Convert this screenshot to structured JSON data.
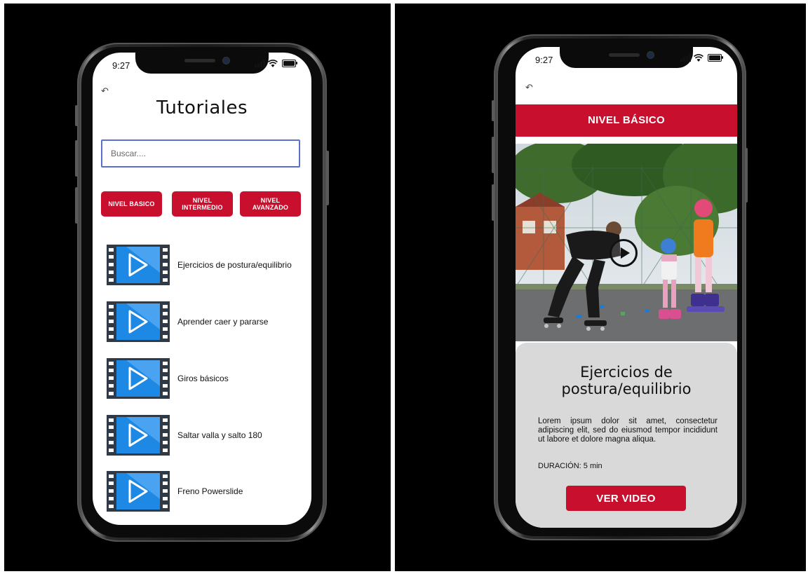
{
  "left_screen": {
    "status": {
      "time": "9:27"
    },
    "back_label": "↶",
    "title": "Tutoriales",
    "search": {
      "placeholder": "Buscar...."
    },
    "levels": [
      {
        "label": "NIVEL BASICO"
      },
      {
        "label": "NIVEL INTERMEDIO"
      },
      {
        "label": "NIVEL AVANZADO"
      }
    ],
    "videos": [
      {
        "title": "Ejercicios de postura/equilibrio",
        "icon": "video-file-icon"
      },
      {
        "title": "Aprender caer y pararse",
        "icon": "video-file-icon"
      },
      {
        "title": "Giros básicos",
        "icon": "video-file-icon"
      },
      {
        "title": "Saltar valla y salto 180",
        "icon": "video-file-icon"
      },
      {
        "title": "Freno Powerslide",
        "icon": "video-file-icon"
      }
    ]
  },
  "right_screen": {
    "status": {
      "time": "9:27"
    },
    "back_label": "↶",
    "header": "NIVEL BÁSICO",
    "video": {
      "icon": "play-icon"
    },
    "title_line1": "Ejercicios de",
    "title_line2": "postura/equilibrio",
    "description": "Lorem ipsum dolor sit amet, consectetur adipiscing elit, sed do eiusmod tempor incididunt ut labore et dolore magna aliqua.",
    "duration": "DURACIÓN: 5 min",
    "button_label": "VER VIDEO"
  },
  "colors": {
    "accent": "#c8102e",
    "search_border": "#5a6fd0",
    "card_bg": "#d9d9d9",
    "thumb_blue": "#1e88e5"
  }
}
